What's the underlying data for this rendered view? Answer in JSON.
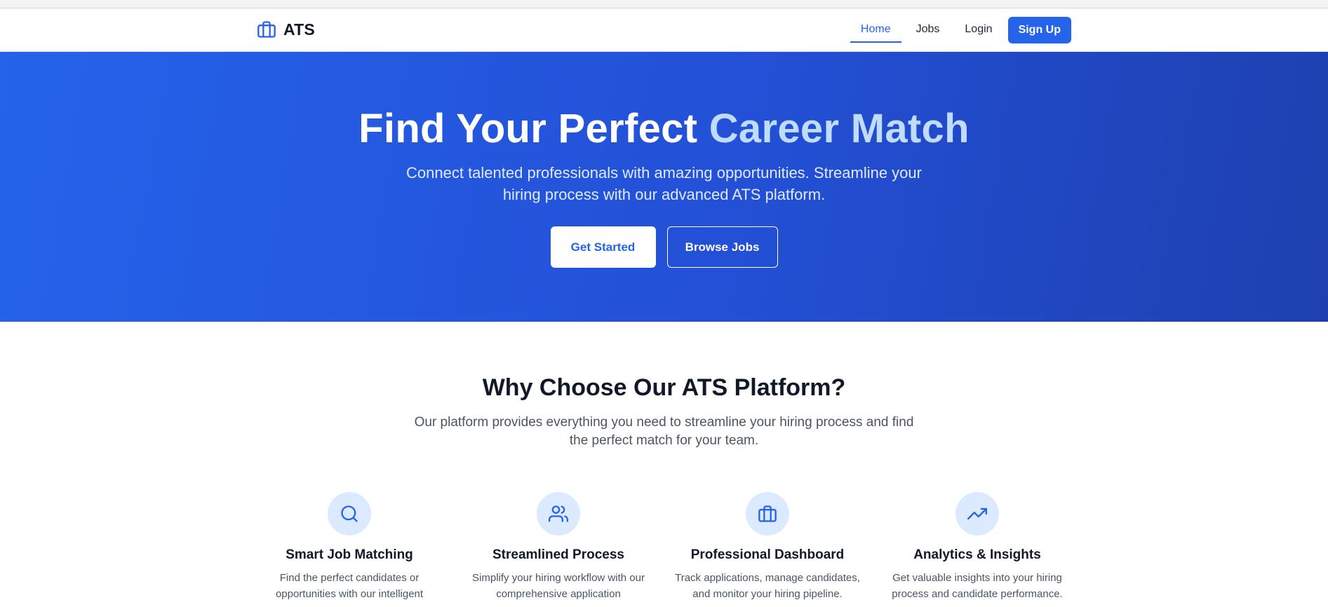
{
  "nav": {
    "brand": "ATS",
    "brand_icon": "briefcase-icon",
    "links": [
      "Home",
      "Jobs",
      "Login"
    ],
    "active": "Home",
    "signup": "Sign Up"
  },
  "hero": {
    "title_main": "Find Your Perfect ",
    "title_accent": "Career Match",
    "subtitle": "Connect talented professionals with amazing opportunities. Streamline your hiring process with our advanced ATS platform.",
    "primary_button": "Get Started",
    "secondary_button": "Browse Jobs"
  },
  "features": {
    "title": "Why Choose Our ATS Platform?",
    "subtitle": "Our platform provides everything you need to streamline your hiring process and find the perfect match for your team.",
    "items": [
      {
        "icon": "search-icon",
        "title": "Smart Job Matching",
        "desc": "Find the perfect candidates or opportunities with our intelligent"
      },
      {
        "icon": "users-icon",
        "title": "Streamlined Process",
        "desc": "Simplify your hiring workflow with our comprehensive application"
      },
      {
        "icon": "briefcase-icon",
        "title": "Professional Dashboard",
        "desc": "Track applications, manage candidates, and monitor your hiring pipeline."
      },
      {
        "icon": "trending-up-icon",
        "title": "Analytics & Insights",
        "desc": "Get valuable insights into your hiring process and candidate performance."
      }
    ]
  },
  "colors": {
    "primary": "#2563eb",
    "hero_accent": "#bfdbfe",
    "icon_bg": "#dbeafe"
  }
}
